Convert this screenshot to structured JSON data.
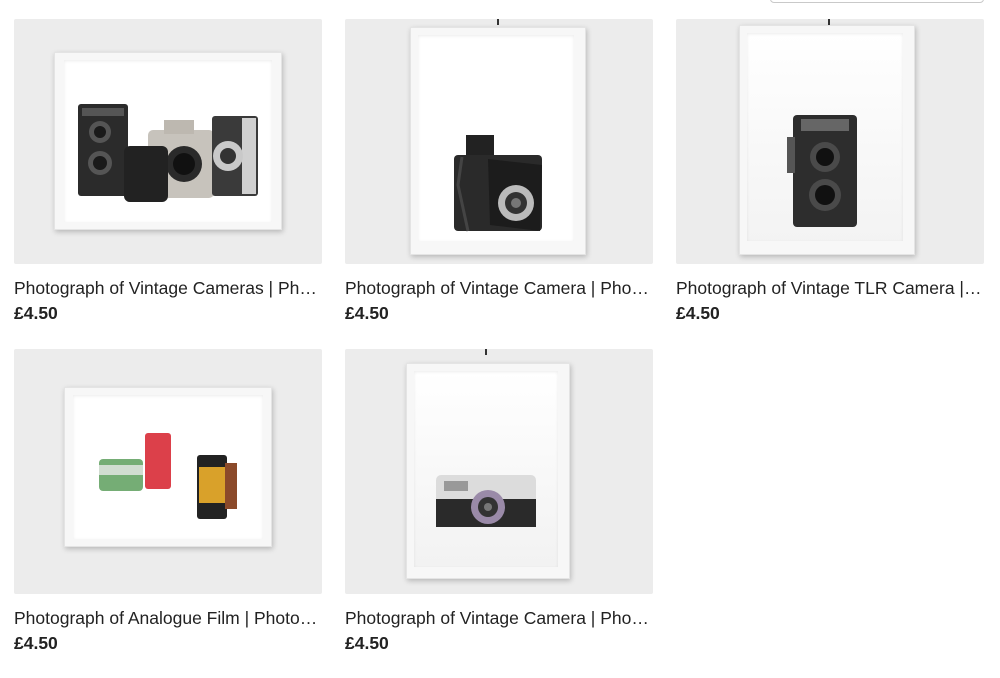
{
  "listings": [
    {
      "title": "Photograph of Vintage Cameras | Photographic Print",
      "price": "£4.50",
      "image_icon": "vintage-cameras-photo"
    },
    {
      "title": "Photograph of Vintage Camera | Photographic Print",
      "price": "£4.50",
      "image_icon": "folding-camera-photo"
    },
    {
      "title": "Photograph of Vintage TLR Camera | Photographic Print",
      "price": "£4.50",
      "image_icon": "tlr-camera-photo"
    },
    {
      "title": "Photograph of Analogue Film | Photographic Print",
      "price": "£4.50",
      "image_icon": "analogue-film-photo"
    },
    {
      "title": "Photograph of Vintage Camera | Photographic Print",
      "price": "£4.50",
      "image_icon": "compact-camera-photo"
    }
  ],
  "colors": {
    "thumb_bg": "#ececec",
    "text": "#222222"
  }
}
